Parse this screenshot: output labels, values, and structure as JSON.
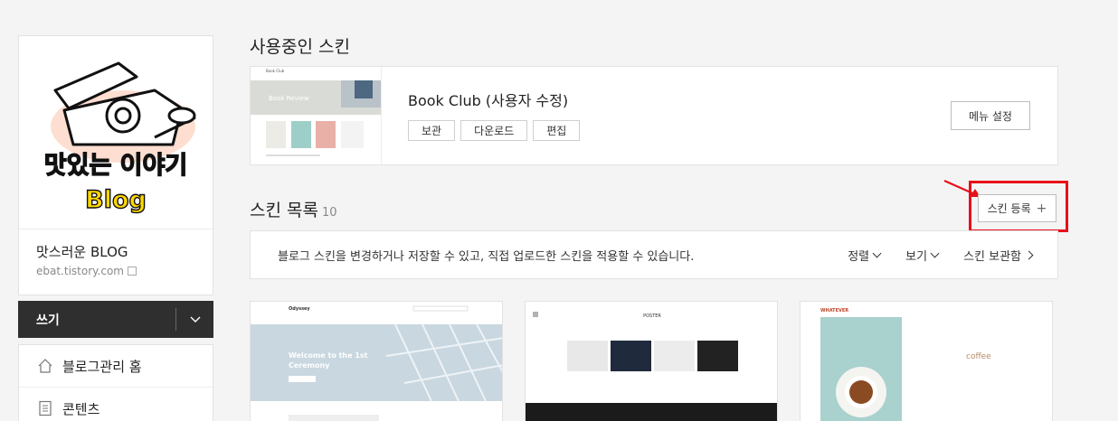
{
  "sidebar": {
    "logo_text_line1": "맛있는 이야기",
    "logo_text_line2": "Blog",
    "blog_name": "맛스러운 BLOG",
    "blog_url": "ebat.tistory.com",
    "write_label": "쓰기",
    "menu": [
      {
        "label": "블로그관리 홈",
        "icon": "home-icon"
      },
      {
        "label": "콘텐츠",
        "icon": "document-icon"
      }
    ]
  },
  "current_skin": {
    "section_title": "사용중인 스킨",
    "name": "Book Club (사용자 수정)",
    "actions": [
      "보관",
      "다운로드",
      "편집"
    ],
    "menu_settings_label": "메뉴 설정",
    "thumb_title": "Book Club",
    "thumb_banner": "Book Review"
  },
  "skin_list": {
    "title": "스킨 목록",
    "count": "10",
    "register_label": "스킨 등록",
    "description": "블로그 스킨을 변경하거나 저장할 수 있고, 직접 업로드한 스킨을 적용할 수 있습니다.",
    "sort_label": "정렬",
    "view_label": "보기",
    "archive_label": "스킨 보관함",
    "cards": [
      {
        "brand": "Odyssey",
        "headline1": "Welcome to the 1st",
        "headline2": "Ceremony"
      },
      {
        "brand": "POSTER"
      },
      {
        "brand": "WHATEVER",
        "headline1": "coffee"
      }
    ]
  },
  "colors": {
    "highlight": "#e8101b",
    "dark_button": "#2f2f2f"
  }
}
